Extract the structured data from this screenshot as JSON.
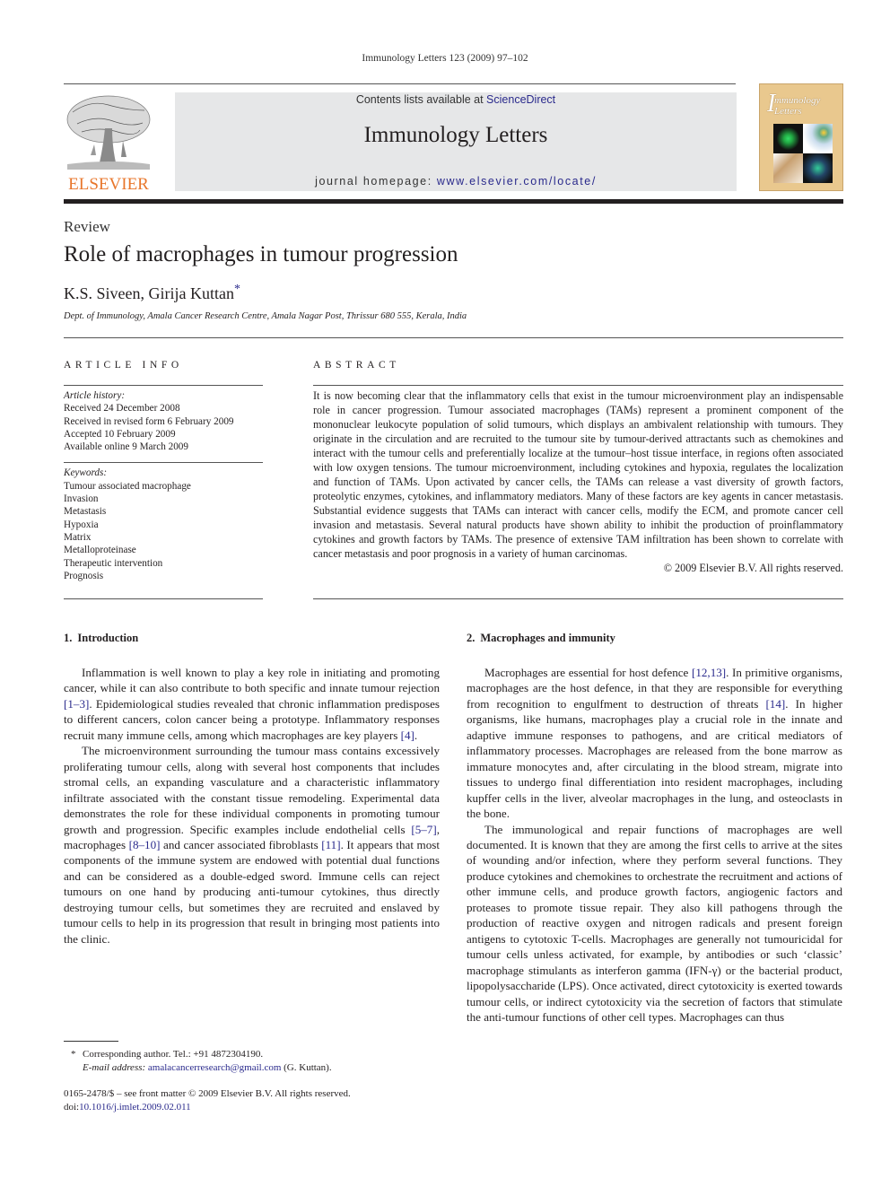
{
  "running_head": "Immunology Letters 123 (2009) 97–102",
  "masthead": {
    "publisher_logo_text": "ELSEVIER",
    "contents_prefix": "Contents lists available at ",
    "contents_link": "ScienceDirect",
    "journal_title": "Immunology Letters",
    "homepage_prefix": "journal homepage: ",
    "homepage_link": "www.elsevier.com/locate/",
    "cover_title_initial": "I",
    "cover_title": "mmunology Letters",
    "colors": {
      "publisher_orange": "#e8762b",
      "banner_gray": "#e6e7e8",
      "link_blue": "#2a2a8c",
      "cover_tan": "#e9c88e"
    }
  },
  "article": {
    "type": "Review",
    "title": "Role of macrophages in tumour progression",
    "authors": "K.S. Siveen, Girija Kuttan",
    "corresponding_mark": "*",
    "affiliation": "Dept. of Immunology, Amala Cancer Research Centre, Amala Nagar Post, Thrissur 680 555, Kerala, India"
  },
  "article_info": {
    "heading": "ARTICLE INFO",
    "history_label": "Article history:",
    "history": [
      "Received 24 December 2008",
      "Received in revised form 6 February 2009",
      "Accepted 10 February 2009",
      "Available online 9 March 2009"
    ],
    "keywords_label": "Keywords:",
    "keywords": [
      "Tumour associated macrophage",
      "Invasion",
      "Metastasis",
      "Hypoxia",
      "Matrix",
      "Metalloproteinase",
      "Therapeutic intervention",
      "Prognosis"
    ]
  },
  "abstract": {
    "heading": "ABSTRACT",
    "text": "It is now becoming clear that the inflammatory cells that exist in the tumour microenvironment play an indispensable role in cancer progression. Tumour associated macrophages (TAMs) represent a prominent component of the mononuclear leukocyte population of solid tumours, which displays an ambivalent relationship with tumours. They originate in the circulation and are recruited to the tumour site by tumour-derived attractants such as chemokines and interact with the tumour cells and preferentially localize at the tumour–host tissue interface, in regions often associated with low oxygen tensions. The tumour microenvironment, including cytokines and hypoxia, regulates the localization and function of TAMs. Upon activated by cancer cells, the TAMs can release a vast diversity of growth factors, proteolytic enzymes, cytokines, and inflammatory mediators. Many of these factors are key agents in cancer metastasis. Substantial evidence suggests that TAMs can interact with cancer cells, modify the ECM, and promote cancer cell invasion and metastasis. Several natural products have shown ability to inhibit the production of proinflammatory cytokines and growth factors by TAMs. The presence of extensive TAM infiltration has been shown to correlate with cancer metastasis and poor prognosis in a variety of human carcinomas.",
    "copyright": "© 2009 Elsevier B.V. All rights reserved."
  },
  "sections": [
    {
      "number": "1.",
      "title": "Introduction",
      "paragraphs": [
        [
          {
            "t": "Inflammation is well known to play a key role in initiating and promoting cancer, while it can also contribute to both specific and innate tumour rejection "
          },
          {
            "ref": "[1–3]"
          },
          {
            "t": ". Epidemiological studies revealed that chronic inflammation predisposes to different cancers, colon cancer being a prototype. Inflammatory responses recruit many immune cells, among which macrophages are key players "
          },
          {
            "ref": "[4]"
          },
          {
            "t": "."
          }
        ],
        [
          {
            "t": "The microenvironment surrounding the tumour mass contains excessively proliferating tumour cells, along with several host components that includes stromal cells, an expanding vasculature and a characteristic inflammatory infiltrate associated with the constant tissue remodeling. Experimental data demonstrates the role for these individual components in promoting tumour growth and progression. Specific examples include endothelial cells "
          },
          {
            "ref": "[5–7]"
          },
          {
            "t": ", macrophages "
          },
          {
            "ref": "[8–10]"
          },
          {
            "t": " and cancer associated fibroblasts "
          },
          {
            "ref": "[11]"
          },
          {
            "t": ". It appears that most components of the immune system are endowed with potential dual functions and can be considered as a double-edged sword. Immune cells can reject tumours on one hand by producing anti-tumour cytokines, thus directly destroying tumour cells, but sometimes they are recruited and enslaved by tumour cells to help in its progression that result in bringing most patients into the clinic."
          }
        ]
      ]
    },
    {
      "number": "2.",
      "title": "Macrophages and immunity",
      "paragraphs": [
        [
          {
            "t": "Macrophages are essential for host defence "
          },
          {
            "ref": "[12,13]"
          },
          {
            "t": ". In primitive organisms, macrophages are the host defence, in that they are responsible for everything from recognition to engulfment to destruction of threats "
          },
          {
            "ref": "[14]"
          },
          {
            "t": ". In higher organisms, like humans, macrophages play a crucial role in the innate and adaptive immune responses to pathogens, and are critical mediators of inflammatory processes. Macrophages are released from the bone marrow as immature monocytes and, after circulating in the blood stream, migrate into tissues to undergo final differentiation into resident macrophages, including kupffer cells in the liver, alveolar macrophages in the lung, and osteoclasts in the bone."
          }
        ],
        [
          {
            "t": "The immunological and repair functions of macrophages are well documented. It is known that they are among the first cells to arrive at the sites of wounding and/or infection, where they perform several functions. They produce cytokines and chemokines to orchestrate the recruitment and actions of other immune cells, and produce growth factors, angiogenic factors and proteases to promote tissue repair. They also kill pathogens through the production of reactive oxygen and nitrogen radicals and present foreign antigens to cytotoxic T-cells. Macrophages are generally not tumouricidal for tumour cells unless activated, for example, by antibodies or such ‘classic’ macrophage stimulants as interferon gamma (IFN-γ) or the bacterial product, lipopolysaccharide (LPS). Once activated, direct cytotoxicity is exerted towards tumour cells, or indirect cytotoxicity via the secretion of factors that stimulate the anti-tumour functions of other cell types. Macrophages can thus"
          }
        ]
      ]
    }
  ],
  "footnote": {
    "mark": "*",
    "corresponding": "Corresponding author. Tel.: +91 4872304190.",
    "email_label": "E-mail address:",
    "email": "amalacancerresearch@gmail.com",
    "email_suffix": " (G. Kuttan)."
  },
  "front_matter": {
    "issn_line": "0165-2478/$ – see front matter © 2009 Elsevier B.V. All rights reserved.",
    "doi_prefix": "doi:",
    "doi": "10.1016/j.imlet.2009.02.011"
  }
}
